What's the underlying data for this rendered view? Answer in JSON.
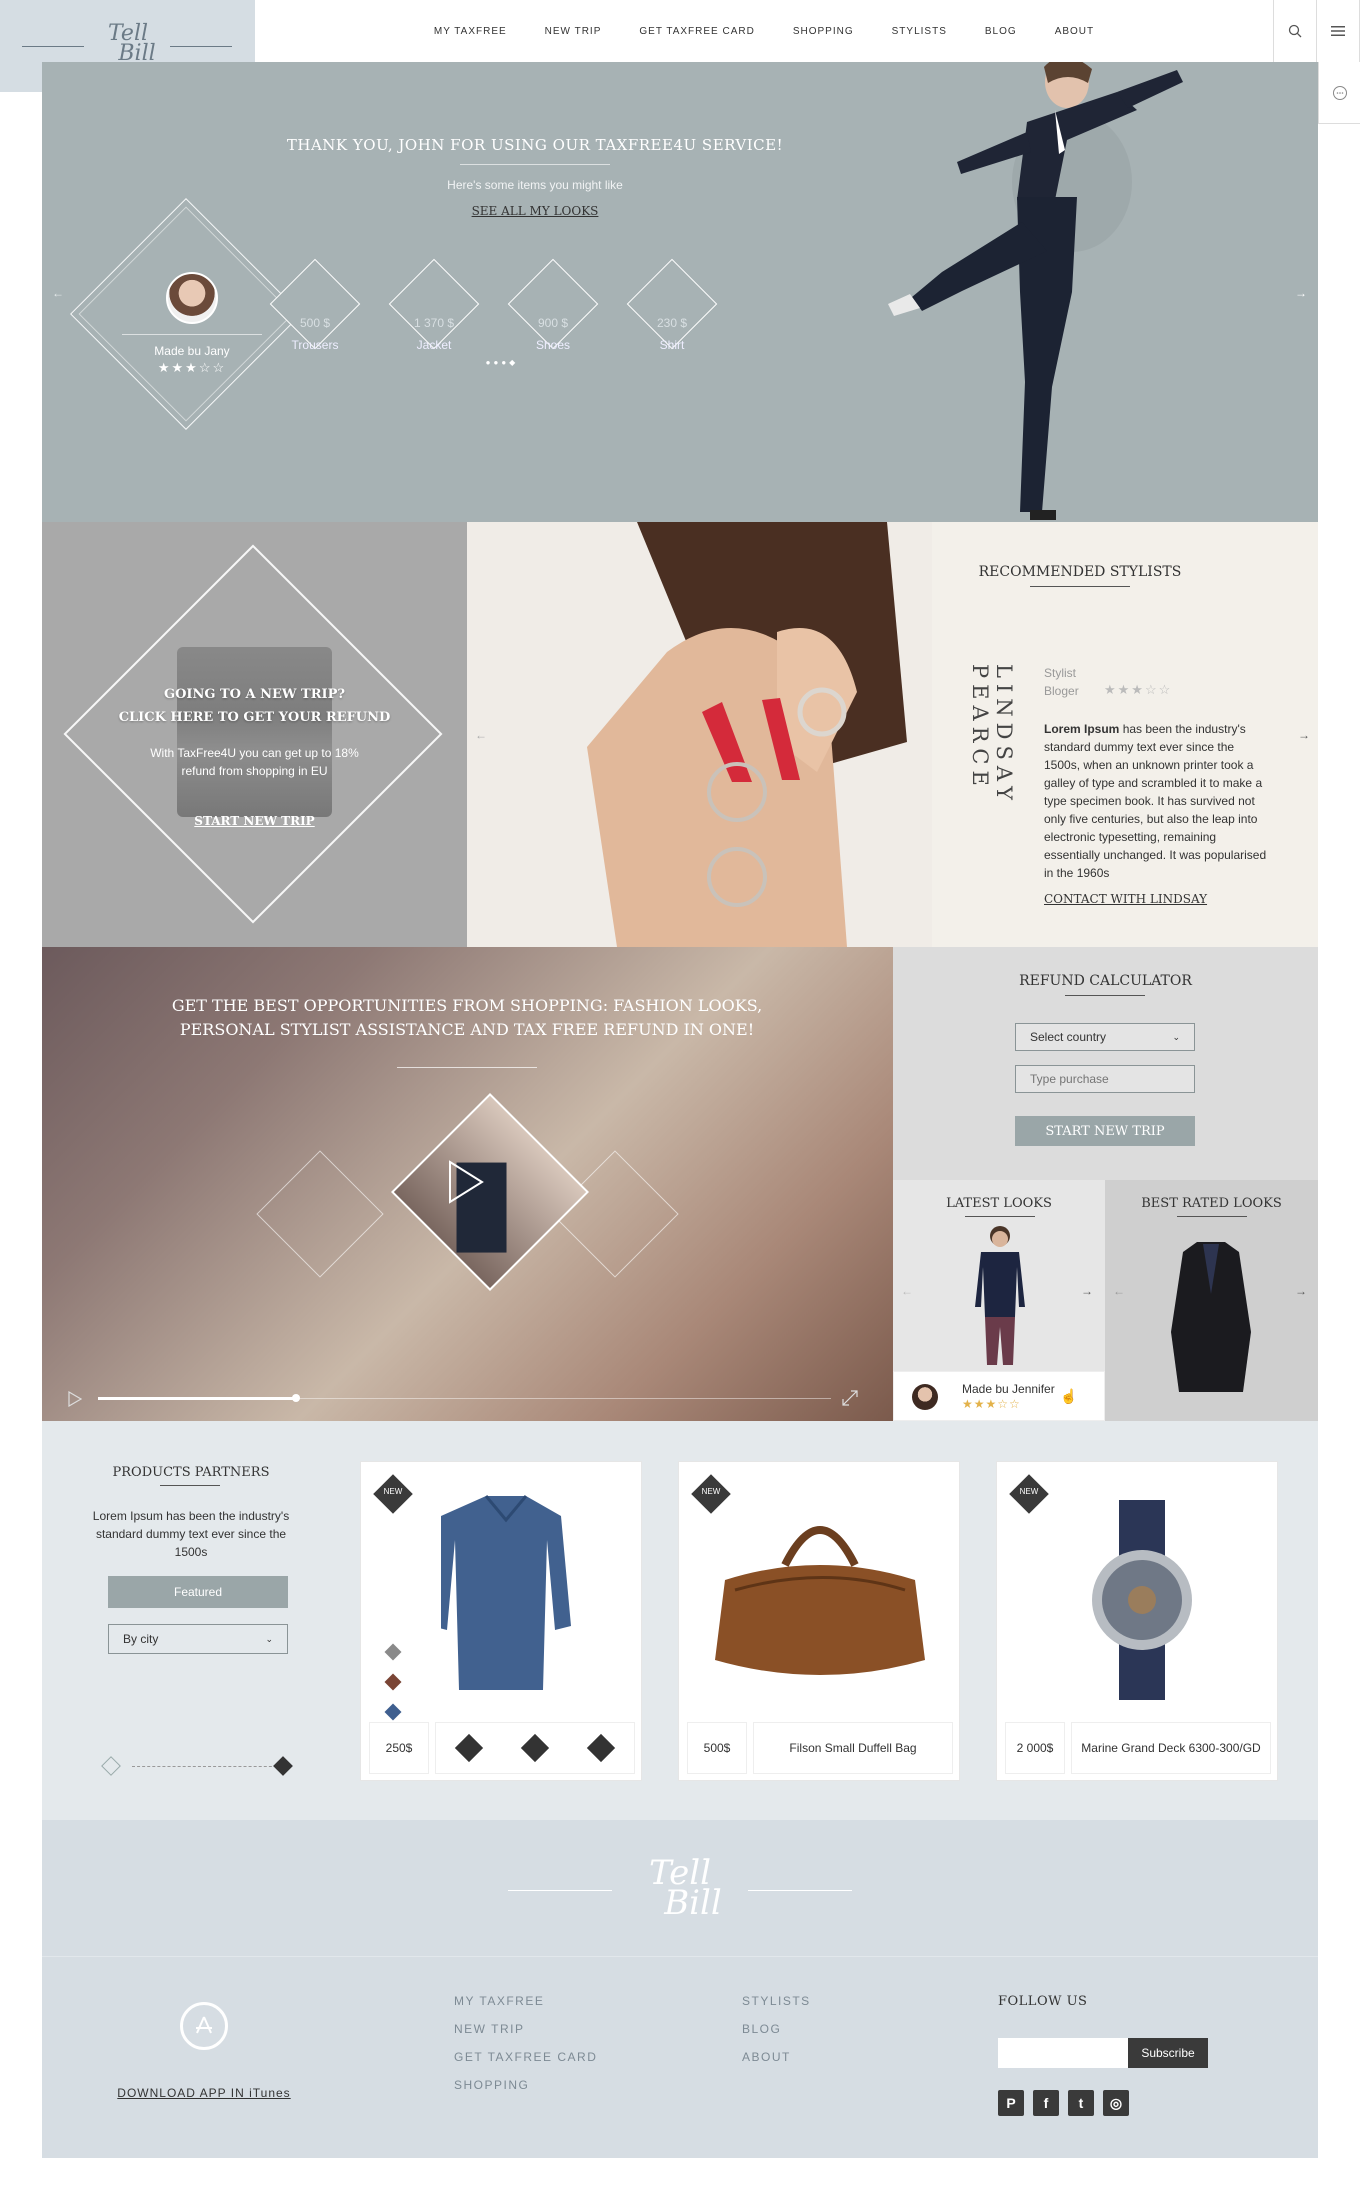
{
  "brand": {
    "logo_line1": "Tell",
    "logo_line2": "Bill"
  },
  "nav": [
    "MY TAXFREE",
    "NEW TRIP",
    "GET TAXFREE CARD",
    "SHOPPING",
    "STYLISTS",
    "BLOG",
    "ABOUT"
  ],
  "hero": {
    "title": "THANK YOU, JOHN FOR USING OUR TAXFREE4U SERVICE!",
    "subtitle": "Here's some items you might like",
    "link": "SEE ALL MY LOOKS",
    "made_by": "Made bu Jany",
    "rating": "★★★☆☆",
    "items": [
      {
        "price": "500 $",
        "name": "Trousers"
      },
      {
        "price": "1 370 $",
        "name": "Jacket"
      },
      {
        "price": "900 $",
        "name": "Shoes"
      },
      {
        "price": "230 $",
        "name": "Shirt"
      }
    ]
  },
  "trip": {
    "title1": "GOING TO A NEW TRIP?",
    "title2": "CLICK HERE TO GET YOUR REFUND",
    "text": "With TaxFree4U you can get up to 18% refund from shopping in EU",
    "link": "START NEW TRIP"
  },
  "stylist": {
    "heading": "RECOMMENDED STYLISTS",
    "name": "LINDSAY PEARCE",
    "role1": "Stylist",
    "role2": "Bloger",
    "rating": "★★★☆☆",
    "bio_bold": "Lorem Ipsum",
    "bio": " has been the industry's standard dummy text ever since the 1500s, when an unknown printer took a galley of type and scrambled it to make a type specimen book. It has survived not only five centuries, but also the leap into electronic typesetting, remaining essentially unchanged. It was popularised in the 1960s",
    "contact": "CONTACT WITH LINDSAY"
  },
  "video": {
    "title1": "GET THE BEST OPPORTUNITIES FROM SHOPPING: FASHION LOOKS,",
    "title2": "PERSONAL STYLIST ASSISTANCE AND TAX FREE REFUND IN ONE!",
    "progress": 0.27
  },
  "calculator": {
    "heading": "REFUND CALCULATOR",
    "country_placeholder": "Select country",
    "purchase_placeholder": "Type purchase",
    "button": "START NEW TRIP"
  },
  "latest": {
    "heading": "LATEST LOOKS",
    "made_by": "Made bu Jennifer",
    "rating": "★★★☆☆"
  },
  "best": {
    "heading": "BEST RATED LOOKS"
  },
  "partners": {
    "heading": "PRODUCTS PARTNERS",
    "text": "Lorem Ipsum has been the industry's standard dummy text ever since the 1500s",
    "featured": "Featured",
    "by_city": "By city",
    "new_label": "NEW",
    "products": [
      {
        "price": "250$",
        "name": ""
      },
      {
        "price": "500$",
        "name": "Filson Small Duffell Bag"
      },
      {
        "price": "2 000$",
        "name": "Marine Grand Deck 6300-300/GD"
      }
    ],
    "swatch_colors": [
      "#8a8a8a",
      "#7a4535",
      "#3f5f8f"
    ]
  },
  "footer": {
    "app_link": "DOWNLOAD APP IN iTunes",
    "col1": [
      "MY TAXFREE",
      "NEW TRIP",
      "GET TAXFREE CARD",
      "SHOPPING"
    ],
    "col2": [
      "STYLISTS",
      "BLOG",
      "ABOUT"
    ],
    "follow": "FOLLOW US",
    "subscribe": "Subscribe",
    "social": [
      "pinterest-icon",
      "facebook-icon",
      "twitter-icon",
      "instagram-icon"
    ]
  },
  "colors": {
    "hero_bg": "#a7b2b4",
    "accent": "#9aa6a8",
    "dark": "#3a3a3a",
    "footer_bg": "#d6dde3"
  }
}
